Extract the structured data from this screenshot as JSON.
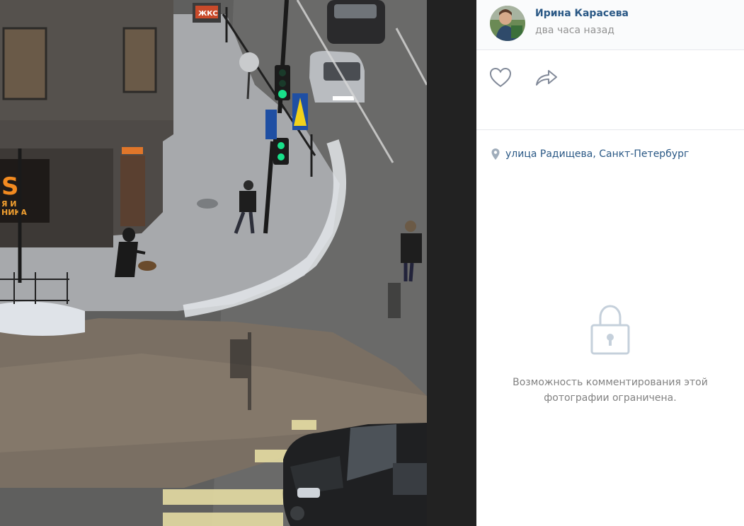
{
  "post": {
    "author_name": "Ирина Карасева",
    "time": "два часа назад"
  },
  "location": {
    "text": "улица Радищева, Санкт-Петербург"
  },
  "comments": {
    "locked_message": "Возможность комментирования этой фотографии ограничена."
  },
  "photo": {
    "storefront_sign_partial": "S",
    "storefront_text_partial": "Я И\nНИКА",
    "sign_badge": "ЖКС"
  },
  "colors": {
    "link": "#2a5885",
    "muted": "#939393",
    "icon": "#828a99",
    "lock": "#c5d0db"
  }
}
